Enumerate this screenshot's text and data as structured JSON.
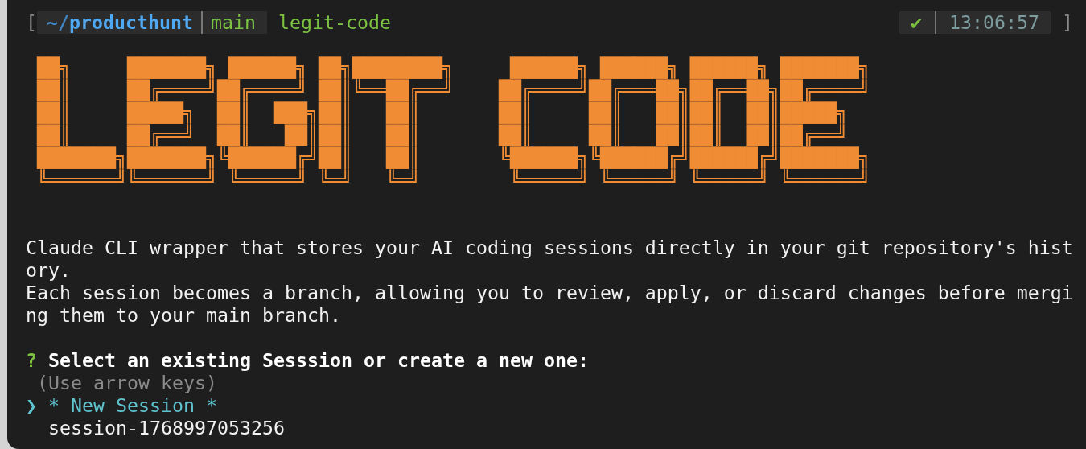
{
  "prompt": {
    "open_bracket": "[",
    "path_prefix": "~/",
    "path": "producthunt",
    "branch": "main",
    "directory": "legit-code",
    "status": "✔",
    "time": "13:06:57",
    "close_bracket": "]"
  },
  "banner": {
    "lines": [
      " ██╗     ███████╗ ██████╗ ██╗████████╗     ██████╗ ██████╗ ██████╗ ███████╗",
      " ██║     ██╔════╝██╔════╝ ██║╚══██╔══╝    ██╔════╝██╔═══██╗██╔══██╗██╔════╝",
      " ██║     █████╗  ██║  ███╗██║   ██║       ██║     ██║   ██║██║  ██║█████╗  ",
      " ██║     ██╔══╝  ██║   ██║██║   ██║       ██║     ██║   ██║██║  ██║██╔══╝  ",
      " ███████╗███████╗╚██████╔╝██║   ██║       ╚██████╗╚██████╔╝██████╔╝███████╗",
      " ╚══════╝╚══════╝ ╚═════╝ ╚═╝   ╚═╝        ╚═════╝ ╚═════╝ ╚═════╝ ╚══════╝"
    ]
  },
  "description": [
    "Claude CLI wrapper that stores your AI coding sessions directly in your git repository's history.",
    "Each session becomes a branch, allowing you to review, apply, or discard changes before merging them to your main branch."
  ],
  "question": {
    "mark": "?",
    "text": "Select an existing Sesssion or create a new one:",
    "hint": "(Use arrow keys)",
    "pointer": "❯"
  },
  "choices": [
    {
      "label": "* New Session *",
      "selected": true
    },
    {
      "label": "session-1768997053256",
      "selected": false
    }
  ]
}
